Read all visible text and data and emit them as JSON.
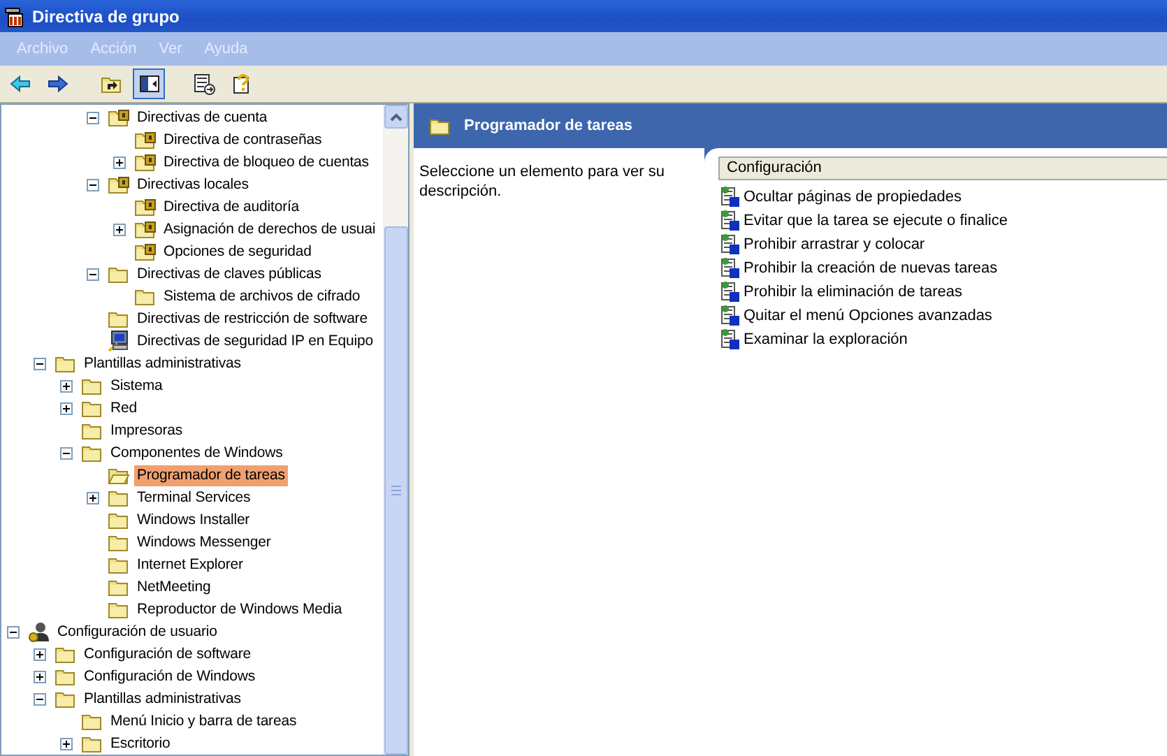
{
  "window": {
    "title": "Directiva de grupo"
  },
  "menu": [
    "Archivo",
    "Acción",
    "Ver",
    "Ayuda"
  ],
  "toolbar": [
    {
      "kind": "back",
      "pressed": false
    },
    {
      "kind": "forward",
      "pressed": false
    },
    {
      "kind": "up",
      "pressed": false
    },
    {
      "kind": "tree",
      "pressed": true
    },
    {
      "kind": "export",
      "pressed": false
    },
    {
      "kind": "help",
      "pressed": false
    }
  ],
  "tree": [
    {
      "children": [
        {
          "children": [
            {
              "children": [
                {
                  "label": "Directivas de cuenta",
                  "kind": "lock",
                  "expanded": true,
                  "selected": false,
                  "children": [
                    {
                      "label": "Directiva de contraseñas",
                      "kind": "lock",
                      "selected": false
                    },
                    {
                      "label": "Directiva de bloqueo de cuentas",
                      "kind": "lock",
                      "expanded": false,
                      "selected": false
                    }
                  ]
                },
                {
                  "label": "Directivas locales",
                  "kind": "lock",
                  "expanded": true,
                  "selected": false,
                  "children": [
                    {
                      "label": "Directiva de auditoría",
                      "kind": "lock",
                      "selected": false
                    },
                    {
                      "label": "Asignación de derechos de usuai",
                      "kind": "lock",
                      "expanded": false,
                      "selected": false
                    },
                    {
                      "label": "Opciones de seguridad",
                      "kind": "lock",
                      "selected": false
                    }
                  ]
                },
                {
                  "label": "Directivas de claves públicas",
                  "kind": "folder",
                  "expanded": true,
                  "selected": false,
                  "children": [
                    {
                      "label": "Sistema de archivos de cifrado",
                      "kind": "folder",
                      "selected": false
                    }
                  ]
                },
                {
                  "label": "Directivas de restricción de software",
                  "kind": "folder",
                  "selected": false
                },
                {
                  "label": "Directivas de seguridad IP en Equipo",
                  "kind": "computer",
                  "selected": false
                }
              ]
            }
          ]
        },
        {
          "label": "Plantillas administrativas",
          "kind": "folder",
          "expanded": true,
          "selected": false,
          "children": [
            {
              "label": "Sistema",
              "kind": "folder",
              "expanded": false,
              "selected": false
            },
            {
              "label": "Red",
              "kind": "folder",
              "expanded": false,
              "selected": false
            },
            {
              "label": "Impresoras",
              "kind": "folder",
              "selected": false
            },
            {
              "label": "Componentes de Windows",
              "kind": "folder",
              "expanded": true,
              "selected": false,
              "children": [
                {
                  "label": "Programador de tareas",
                  "kind": "open-folder",
                  "selected": true
                },
                {
                  "label": "Terminal Services",
                  "kind": "folder",
                  "expanded": false,
                  "selected": false
                },
                {
                  "label": "Windows Installer",
                  "kind": "folder",
                  "selected": false
                },
                {
                  "label": "Windows Messenger",
                  "kind": "folder",
                  "selected": false
                },
                {
                  "label": "Internet Explorer",
                  "kind": "folder",
                  "selected": false
                },
                {
                  "label": "NetMeeting",
                  "kind": "folder",
                  "selected": false
                },
                {
                  "label": "Reproductor de Windows Media",
                  "kind": "folder",
                  "selected": false
                }
              ]
            }
          ]
        }
      ]
    },
    {
      "label": "Configuración de usuario",
      "kind": "user",
      "expanded": true,
      "selected": false,
      "children": [
        {
          "label": "Configuración de software",
          "kind": "folder",
          "expanded": false,
          "selected": false
        },
        {
          "label": "Configuración de Windows",
          "kind": "folder",
          "expanded": false,
          "selected": false
        },
        {
          "label": "Plantillas administrativas",
          "kind": "folder",
          "expanded": true,
          "selected": false,
          "children": [
            {
              "label": "Menú Inicio y barra de tareas",
              "kind": "folder",
              "selected": false
            },
            {
              "label": "Escritorio",
              "kind": "folder",
              "expanded": false,
              "selected": false
            }
          ]
        }
      ]
    }
  ],
  "details": {
    "title": "Programador de tareas",
    "description": "Seleccione un elemento para ver su descripción.",
    "column": "Configuración",
    "settings": [
      "Ocultar páginas de propiedades",
      "Evitar que la tarea se ejecute o finalice",
      "Prohibir arrastrar y colocar",
      "Prohibir la creación de nuevas tareas",
      "Prohibir la eliminación de tareas",
      "Quitar el menú Opciones avanzadas",
      "Examinar la exploración"
    ]
  }
}
